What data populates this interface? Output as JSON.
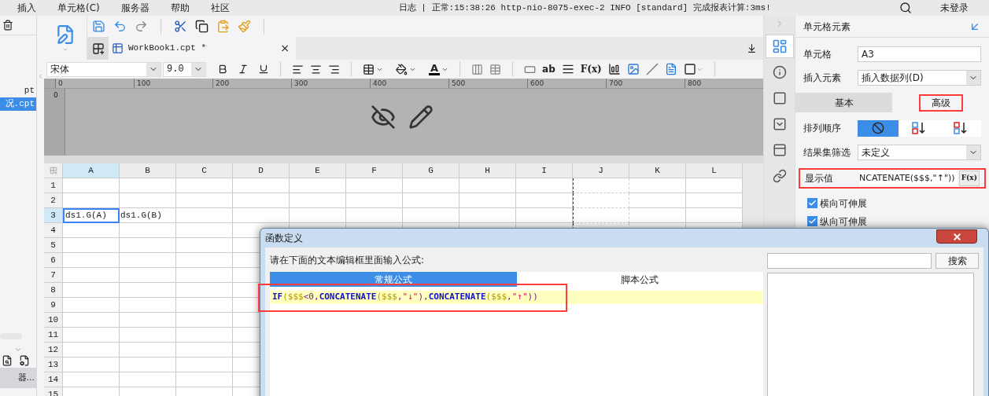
{
  "menu": [
    "插入",
    "单元格(C)",
    "服务器",
    "帮助",
    "社区"
  ],
  "log": "日志 | 正常:15:38:26 http-nio-8075-exec-2 INFO [standard] 完成报表计算:3ms!",
  "login": "未登录",
  "file_tree": [
    {
      "label": "pt",
      "selected": false
    },
    {
      "label": "况.cpt",
      "selected": true
    }
  ],
  "left_bottom": [
    {
      "label": "器...",
      "selected": true
    }
  ],
  "tab": {
    "label": "WorkBook1.cpt *",
    "close": "×"
  },
  "format": {
    "font": "宋体",
    "size": "9.0",
    "font_color": "A",
    "text_tool": "ab",
    "formula_tool": "F(x)"
  },
  "ruler": [
    "0",
    "100",
    "200",
    "300",
    "400",
    "500",
    "600",
    "700",
    "800"
  ],
  "vruler": [
    "0"
  ],
  "columns": [
    {
      "label": "A",
      "selected": true,
      "page_break": false
    },
    {
      "label": "B",
      "selected": false,
      "page_break": false
    },
    {
      "label": "C",
      "selected": false,
      "page_break": false
    },
    {
      "label": "D",
      "selected": false,
      "page_break": false
    },
    {
      "label": "E",
      "selected": false,
      "page_break": false
    },
    {
      "label": "F",
      "selected": false,
      "page_break": false
    },
    {
      "label": "G",
      "selected": false,
      "page_break": false
    },
    {
      "label": "H",
      "selected": false,
      "page_break": false
    },
    {
      "label": "I",
      "selected": false,
      "page_break": false
    },
    {
      "label": "J",
      "selected": false,
      "page_break": true
    },
    {
      "label": "K",
      "selected": false,
      "page_break": false
    },
    {
      "label": "L",
      "selected": false,
      "page_break": false
    }
  ],
  "rows": [
    {
      "label": "1",
      "selected": false
    },
    {
      "label": "2",
      "selected": false
    },
    {
      "label": "3",
      "selected": true,
      "cells": [
        {
          "text": "ds1.G(A)",
          "selected": true
        },
        {
          "text": "ds1.G(B)",
          "selected": false
        }
      ]
    },
    {
      "label": "4",
      "selected": false
    },
    {
      "label": "5",
      "selected": false
    },
    {
      "label": "6",
      "selected": false
    },
    {
      "label": "7",
      "selected": false
    },
    {
      "label": "8",
      "selected": false
    },
    {
      "label": "9",
      "selected": false
    },
    {
      "label": "10",
      "selected": false
    },
    {
      "label": "11",
      "selected": false
    },
    {
      "label": "12",
      "selected": false
    },
    {
      "label": "13",
      "selected": false
    },
    {
      "label": "14",
      "selected": false
    },
    {
      "label": "15",
      "selected": false
    }
  ],
  "side_icons": [
    {
      "kind": "cell-element",
      "selected": true
    },
    {
      "kind": "cell-attribute",
      "selected": false
    },
    {
      "kind": "border",
      "selected": false
    },
    {
      "kind": "widget",
      "selected": false
    },
    {
      "kind": "layout",
      "selected": false
    },
    {
      "kind": "link",
      "selected": false
    }
  ],
  "panel": {
    "title": "单元格元素",
    "fields": [
      {
        "label": "单元格",
        "value": "A3",
        "kind": "input"
      },
      {
        "label": "插入元素",
        "value": "插入数据列(D)",
        "kind": "select"
      }
    ],
    "tabs": [
      {
        "label": "基本",
        "selected": false,
        "highlighted": false
      },
      {
        "label": "高级",
        "selected": true,
        "highlighted": true
      }
    ],
    "sort": {
      "label": "排列顺序",
      "options": [
        {
          "kind": "none",
          "selected": true
        },
        {
          "kind": "asc",
          "selected": false
        },
        {
          "kind": "desc",
          "selected": false
        }
      ]
    },
    "filter": {
      "label": "结果集筛选",
      "value": "未定义"
    },
    "display": {
      "label": "显示值",
      "value": "NCATENATE($$$,\"↑\"))",
      "button": "F(x)",
      "highlighted": true
    },
    "checks": [
      {
        "label": "横向可伸展",
        "checked": true
      },
      {
        "label": "纵向可伸展",
        "checked": true
      }
    ]
  },
  "dialog": {
    "title": "函数定义",
    "prompt": "请在下面的文本编辑框里面输入公式:",
    "search_button": "搜索",
    "tabs": [
      {
        "label": "常规公式",
        "selected": true
      },
      {
        "label": "脚本公式",
        "selected": false
      }
    ],
    "formula": {
      "highlighted": true,
      "tokens": [
        {
          "text": "IF",
          "kind": "func"
        },
        {
          "text": "($$$",
          "kind": "var"
        },
        {
          "text": "<0,",
          "kind": "op"
        },
        {
          "text": "CONCATENATE",
          "kind": "func"
        },
        {
          "text": "($$$",
          "kind": "var"
        },
        {
          "text": ",",
          "kind": "op"
        },
        {
          "text": "\"↓\"",
          "kind": "str"
        },
        {
          "text": "),",
          "kind": "op"
        },
        {
          "text": "CONCATENATE",
          "kind": "func"
        },
        {
          "text": "($$$",
          "kind": "var"
        },
        {
          "text": ",",
          "kind": "op"
        },
        {
          "text": "\"↑\"",
          "kind": "str"
        },
        {
          "text": "))",
          "kind": "op"
        }
      ]
    }
  }
}
